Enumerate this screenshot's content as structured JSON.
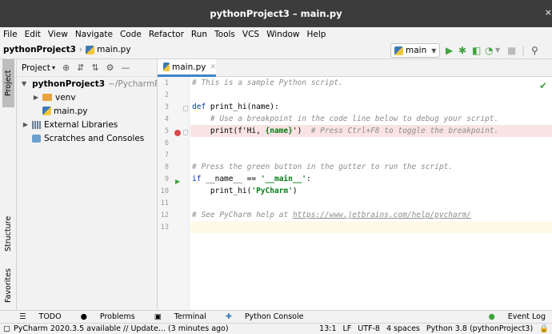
{
  "window": {
    "title": "pythonProject3 – main.py",
    "close": "×"
  },
  "menu": [
    "File",
    "Edit",
    "View",
    "Navigate",
    "Code",
    "Refactor",
    "Run",
    "Tools",
    "VCS",
    "Window",
    "Help"
  ],
  "breadcrumb": {
    "project": "pythonProject3",
    "file": "main.py"
  },
  "toolbar": {
    "branch": "main"
  },
  "side_tabs": {
    "project": "Project",
    "structure": "Structure",
    "favorites": "Favorites"
  },
  "project_panel": {
    "header": "Project",
    "tree": [
      {
        "label": "pythonProject3",
        "path": "~/PycharmPro"
      },
      {
        "label": "venv"
      },
      {
        "label": "main.py"
      },
      {
        "label": "External Libraries"
      },
      {
        "label": "Scratches and Consoles"
      }
    ]
  },
  "editor": {
    "tab": "main.py",
    "line_numbers": [
      "1",
      "2",
      "3",
      "4",
      "5",
      "6",
      "7",
      "8",
      "9",
      "10",
      "11",
      "12",
      "13"
    ],
    "lines": {
      "l1": "# This is a sample Python script.",
      "l3_kw": "def",
      "l3_rest": " print_hi(name):",
      "l4": "    # Use a breakpoint in the code line below to debug your script.",
      "l5_a": "    print(f'Hi, ",
      "l5_b": "{name}",
      "l5_c": "')",
      "l5_cm": "  # Press Ctrl+F8 to toggle the breakpoint.",
      "l8": "# Press the green button in the gutter to run the script.",
      "l9_kw": "if",
      "l9_a": " __name__ == ",
      "l9_str": "'__main__'",
      "l9_b": ":",
      "l10_a": "    print_hi(",
      "l10_str": "'PyCharm'",
      "l10_b": ")",
      "l12_cm": "# See PyCharm help at ",
      "l12_link": "https://www.jetbrains.com/help/pycharm/"
    }
  },
  "tool_windows": {
    "todo": "TODO",
    "problems": "Problems",
    "terminal": "Terminal",
    "console": "Python Console",
    "event_log": "Event Log"
  },
  "status": {
    "message": "PyCharm 2020.3.5 available // Update... (3 minutes ago)",
    "position": "13:1",
    "line_sep": "LF",
    "encoding": "UTF-8",
    "indent": "4 spaces",
    "interpreter": "Python 3.8 (pythonProject3)"
  },
  "colors": {
    "folder_orange": "#e8a33d",
    "folder_gray": "#9aa7b0",
    "accent": "#4083c9",
    "run_green": "#3fa33f",
    "breakpoint_red": "#d94b4b"
  }
}
